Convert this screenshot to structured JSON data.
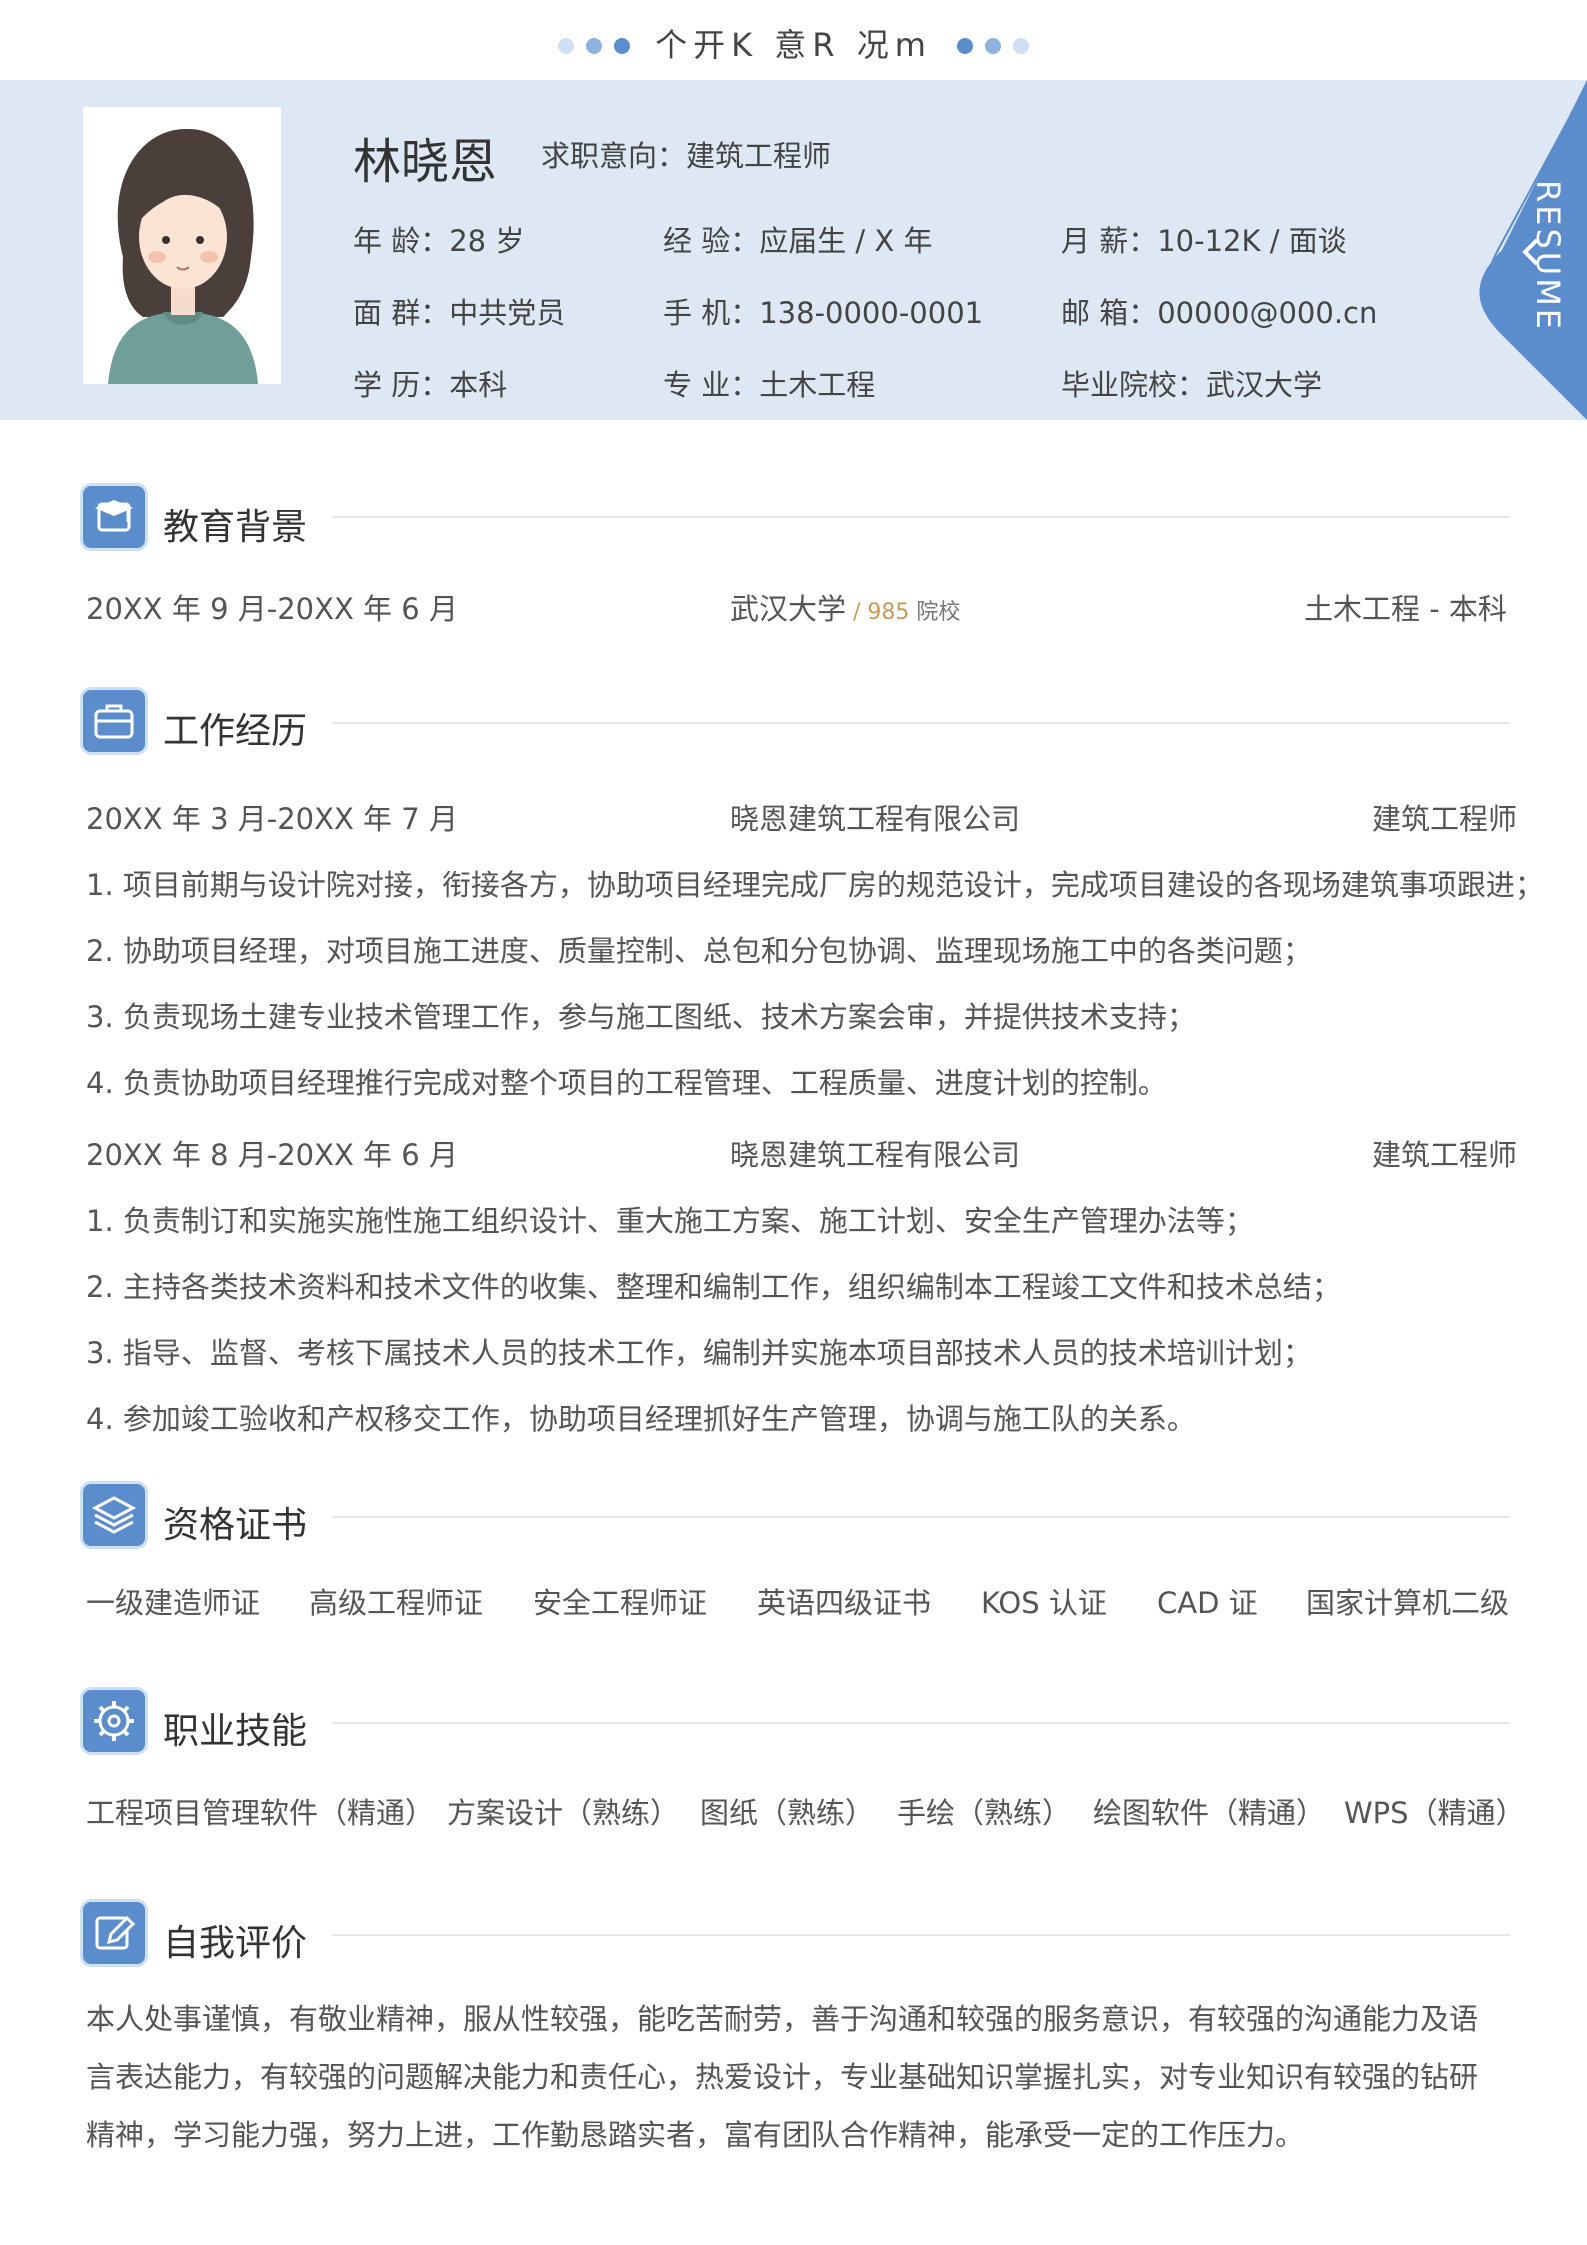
{
  "page_title": "个开K 意R 况m",
  "colors": {
    "accent": "#5b8ccc",
    "header_bg": "#dde8f4",
    "gold": "#c99a5a"
  },
  "profile": {
    "name": "林晓恩",
    "intent": "求职意向：建筑工程师",
    "age": "年  龄：28 岁",
    "experience": "经  验：应届生 / X 年",
    "salary": "月  薪：10-12K / 面谈",
    "political": "面  群：中共党员",
    "phone": "手  机：138-0000-0001",
    "email": "邮  箱：00000@000.cn",
    "degree": "学  历：本科",
    "major": "专  业：土木工程",
    "school": "毕业院校：武汉大学",
    "ribbon_text": "RESUME"
  },
  "education": {
    "title": "教育背景",
    "period": "20XX 年 9 月-20XX 年 6 月",
    "school": "武汉大学",
    "school_tag": " / 985",
    "school_tag2": " 院校",
    "major": "土木工程  -  本科"
  },
  "work": {
    "title": "工作经历",
    "jobs": [
      {
        "period": "20XX 年 3 月-20XX 年 7 月",
        "company": "晓恩建筑工程有限公司",
        "role": "建筑工程师",
        "duties": [
          "1.    项目前期与设计院对接，衔接各方，协助项目经理完成厂房的规范设计，完成项目建设的各现场建筑事项跟进；",
          "2.    协助项目经理，对项目施工进度、质量控制、总包和分包协调、监理现场施工中的各类问题；",
          "3.    负责现场土建专业技术管理工作，参与施工图纸、技术方案会审，并提供技术支持；",
          "4.    负责协助项目经理推行完成对整个项目的工程管理、工程质量、进度计划的控制。"
        ]
      },
      {
        "period": "20XX 年 8 月-20XX 年 6 月",
        "company": "晓恩建筑工程有限公司",
        "role": "建筑工程师",
        "duties": [
          "1.    负责制订和实施实施性施工组织设计、重大施工方案、施工计划、安全生产管理办法等；",
          "2.    主持各类技术资料和技术文件的收集、整理和编制工作，组织编制本工程竣工文件和技术总结；",
          "3.    指导、监督、考核下属技术人员的技术工作，编制并实施本项目部技术人员的技术培训计划；",
          "4.    参加竣工验收和产权移交工作，协助项目经理抓好生产管理，协调与施工队的关系。"
        ]
      }
    ]
  },
  "certs": {
    "title": "资格证书",
    "items": [
      "一级建造师证",
      "高级工程师证",
      "安全工程师证",
      "英语四级证书",
      "KOS 认证",
      "CAD 证",
      "国家计算机二级"
    ]
  },
  "skills": {
    "title": "职业技能",
    "items": [
      "工程项目管理软件（精通）",
      "方案设计（熟练）",
      "图纸（熟练）",
      "手绘（熟练）",
      "绘图软件（精通）",
      "WPS（精通）"
    ]
  },
  "self_eval": {
    "title": "自我评价",
    "text": "本人处事谨慎，有敬业精神，服从性较强，能吃苦耐劳，善于沟通和较强的服务意识，有较强的沟通能力及语言表达能力，有较强的问题解决能力和责任心，热爱设计，专业基础知识掌握扎实，对专业知识有较强的钻研精神，学习能力强，努力上进，工作勤恳踏实者，富有团队合作精神，能承受一定的工作压力。"
  }
}
